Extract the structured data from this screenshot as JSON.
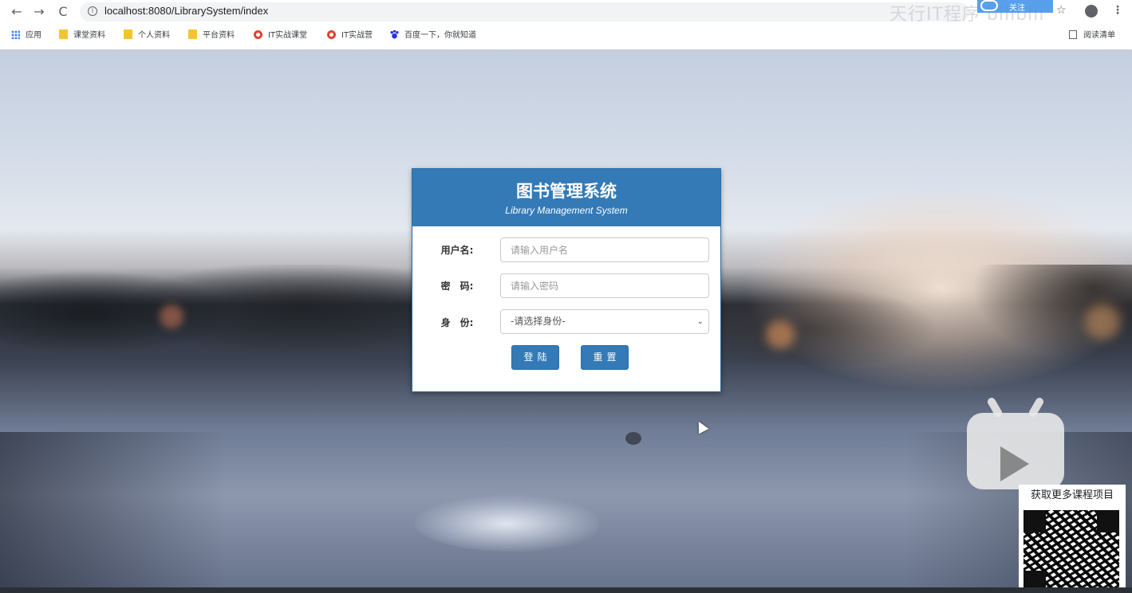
{
  "browser": {
    "url": "localhost:8080/LibrarySystem/index",
    "nav": {
      "back": "←",
      "forward": "→",
      "reload": "C"
    },
    "extension_label": "关注",
    "watermark_top": "天行IT程序 bilibili",
    "bookmarks": [
      {
        "label": "应用",
        "icon": "apps-grid-icon"
      },
      {
        "label": "课堂资料",
        "icon": "folder-icon"
      },
      {
        "label": "个人资料",
        "icon": "folder-icon"
      },
      {
        "label": "平台资料",
        "icon": "folder-icon"
      },
      {
        "label": "IT实战课堂",
        "icon": "red-site-icon"
      },
      {
        "label": "IT实战营",
        "icon": "red-site-icon"
      },
      {
        "label": "百度一下，你就知道",
        "icon": "baidu-paw-icon"
      }
    ],
    "reading_list": "阅读清单"
  },
  "login": {
    "title": "图书管理系统",
    "subtitle": "Library Management System",
    "username_label": "用户名:",
    "username_placeholder": "请输入用户名",
    "password_label": "密　码:",
    "password_placeholder": "请输入密码",
    "role_label": "身　份:",
    "role_selected": "-请选择身份-",
    "login_button": "登陆",
    "reset_button": "重置"
  },
  "overlay": {
    "qr_caption": "获取更多课程项目"
  },
  "colors": {
    "primary": "#337ab7",
    "primary_border": "#2e6da4"
  }
}
